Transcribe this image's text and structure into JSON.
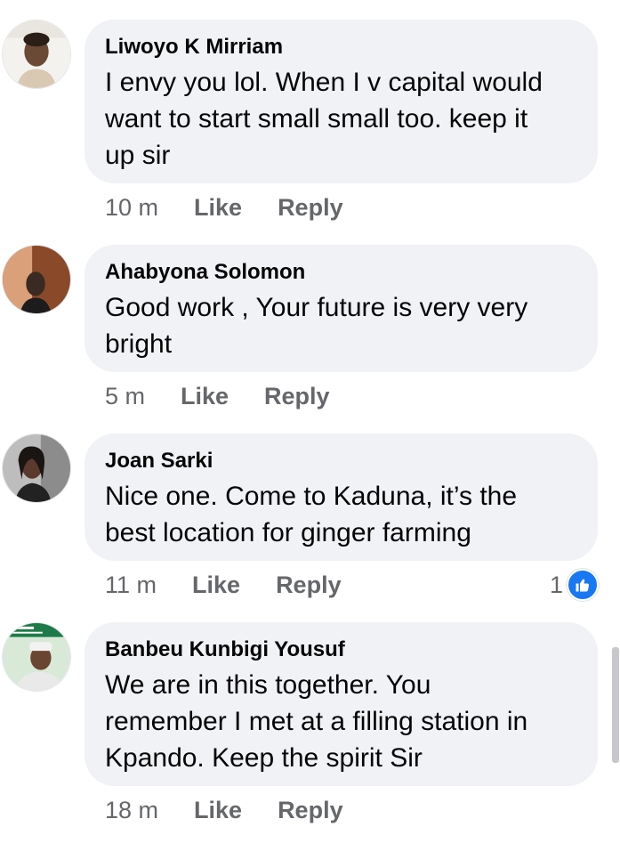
{
  "comments": [
    {
      "author": "Liwoyo K Mirriam",
      "lines": [
        "I envy you lol. When I v capital would",
        "want to start small small too. keep it",
        "up sir"
      ],
      "time": "10 m",
      "like_label": "Like",
      "reply_label": "Reply"
    },
    {
      "author": "Ahabyona Solomon",
      "lines": [
        "Good work , Your future is very very",
        "bright"
      ],
      "time": "5 m",
      "like_label": "Like",
      "reply_label": "Reply"
    },
    {
      "author": "Joan Sarki",
      "lines": [
        "Nice one. Come to Kaduna, it’s the",
        "best location for ginger farming"
      ],
      "time": "11 m",
      "like_label": "Like",
      "reply_label": "Reply",
      "reaction_count": "1",
      "reaction_icon": "thumbs-up-icon"
    },
    {
      "author": "Banbeu Kunbigi Yousuf",
      "lines": [
        "We are in this together. You",
        "remember I met at a filling station in",
        "Kpando. Keep the spirit Sir"
      ],
      "time": "18 m",
      "like_label": "Like",
      "reply_label": "Reply"
    }
  ],
  "colors": {
    "bubble_bg": "#f0f2f5",
    "meta_text": "#65676b",
    "like_reaction": "#1877f2"
  }
}
